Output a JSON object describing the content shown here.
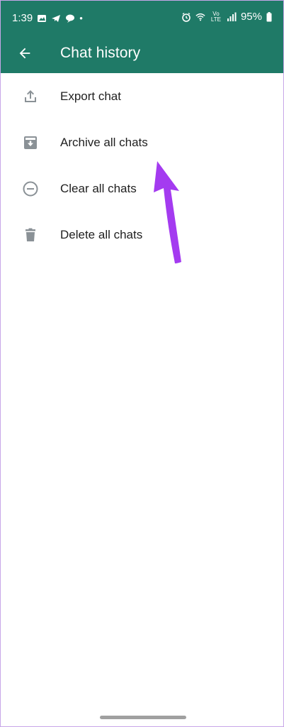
{
  "status_bar": {
    "time": "1:39",
    "dot": "•",
    "network": "Vo LTE",
    "battery": "95%"
  },
  "toolbar": {
    "title": "Chat history"
  },
  "menu": {
    "items": [
      {
        "label": "Export chat",
        "icon": "export-icon"
      },
      {
        "label": "Archive all chats",
        "icon": "archive-icon"
      },
      {
        "label": "Clear all chats",
        "icon": "clear-icon"
      },
      {
        "label": "Delete all chats",
        "icon": "trash-icon"
      }
    ]
  },
  "colors": {
    "header": "#1f7a67",
    "icon": "#8a9196",
    "arrow": "#a43bf0"
  }
}
